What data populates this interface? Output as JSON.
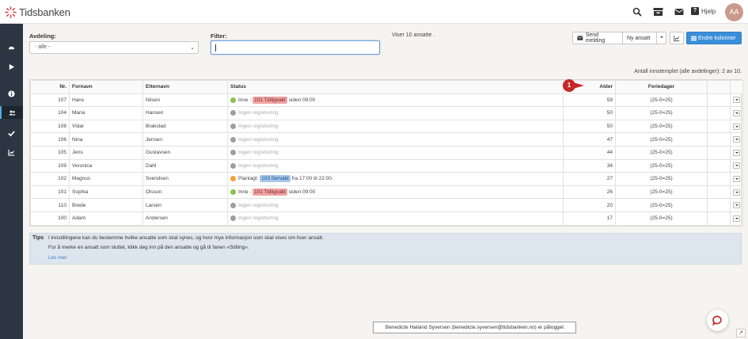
{
  "header": {
    "app_name": "Tidsbanken",
    "help_label": "Hjelp",
    "avatar_initials": "AA"
  },
  "filters": {
    "department_label": "Avdeling:",
    "department_value": "- alle -",
    "filter_label": "Filter:",
    "filter_value": "",
    "showing_text": "Viser 10 ansatte ."
  },
  "toolbar": {
    "send_message": "Send melding",
    "new_employee": "Ny ansatt",
    "change_columns": "Endre kolonner"
  },
  "punched_in_text": "Antall innstemplet (alle avdelinger): 2 av 10.",
  "table": {
    "columns": [
      "Nr.",
      "Fornavn",
      "Etternavn",
      "Status",
      "Alder",
      "Feriedager"
    ],
    "rows": [
      {
        "nr": "107",
        "first": "Hans",
        "last": "Nilsen",
        "status_type": "in",
        "status_prefix": "Inne :",
        "badge": "101 Tidligvakt",
        "badge_color": "red",
        "status_suffix": "siden 09:00",
        "age": "59",
        "vacation": "(25-0=25)"
      },
      {
        "nr": "104",
        "first": "Maria",
        "last": "Hansen",
        "status_type": "none",
        "status_text": "Ingen registrering",
        "age": "50",
        "vacation": "(25-0=25)"
      },
      {
        "nr": "108",
        "first": "Vidar",
        "last": "Brakstad",
        "status_type": "none",
        "status_text": "Ingen registrering",
        "age": "50",
        "vacation": "(25-0=25)"
      },
      {
        "nr": "106",
        "first": "Nina",
        "last": "Jensen",
        "status_type": "none",
        "status_text": "Ingen registrering",
        "age": "47",
        "vacation": "(25-0=25)"
      },
      {
        "nr": "105",
        "first": "Jens",
        "last": "Gustavsen",
        "status_type": "none",
        "status_text": "Ingen registrering",
        "age": "44",
        "vacation": "(25-0=25)"
      },
      {
        "nr": "109",
        "first": "Veronica",
        "last": "Dahl",
        "status_type": "none",
        "status_text": "Ingen registrering",
        "age": "34",
        "vacation": "(25-0=25)"
      },
      {
        "nr": "102",
        "first": "Magnus",
        "last": "Svendsen",
        "status_type": "planned",
        "status_prefix": "Planlagt:",
        "badge": "103 Servakt",
        "badge_color": "blue",
        "status_suffix": "fra 17:00 til 22:00.",
        "age": "27",
        "vacation": "(25-0=25)"
      },
      {
        "nr": "101",
        "first": "Sophia",
        "last": "Olsson",
        "status_type": "in",
        "status_prefix": "Inne :",
        "badge": "101 Tidligvakt",
        "badge_color": "red",
        "status_suffix": "siden 09:00",
        "age": "26",
        "vacation": "(25-0=25)"
      },
      {
        "nr": "110",
        "first": "Brede",
        "last": "Larsen",
        "status_type": "none",
        "status_text": "Ingen registrering",
        "age": "20",
        "vacation": "(25-0=25)"
      },
      {
        "nr": "100",
        "first": "Adam",
        "last": "Andersen",
        "status_type": "none",
        "status_text": "Ingen registrering",
        "age": "17",
        "vacation": "(25-0=25)"
      }
    ]
  },
  "marker_number": "1",
  "tips": {
    "title": "Tips",
    "line1": "I innstillingene kan du bestemme hvilke ansatte som skal synes, og hvor mye informasjon som skal vises om hver ansatt.",
    "line2": "For å merke en ansatt som sluttet, klikk deg inn på den ansatte og gå til fanen «Stilling».",
    "link": "Les mer"
  },
  "logged_in_text": "Benedicte Hailand Syversen (benedicte.syversen@tidsbanken.no) er pålogget",
  "colors": {
    "sidebar": "#2b3642",
    "primary": "#3a8fd8",
    "marker": "#c62828"
  }
}
